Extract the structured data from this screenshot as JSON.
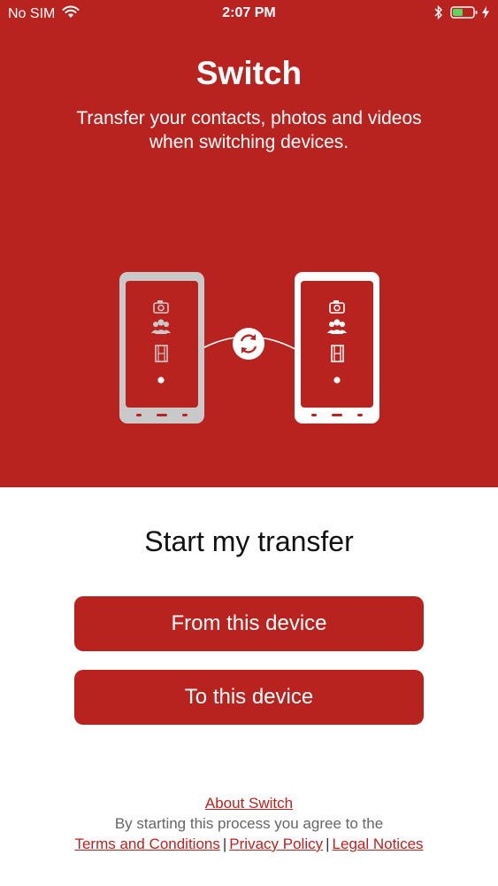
{
  "status_bar": {
    "carrier": "No SIM",
    "time": "2:07 PM",
    "wifi_icon": "wifi-icon",
    "bluetooth_icon": "bluetooth-icon",
    "battery_icon": "battery-icon",
    "charging_icon": "charging-bolt-icon"
  },
  "header": {
    "title": "Switch",
    "subtitle": "Transfer your contacts, photos and videos when switching devices."
  },
  "illustration": {
    "icons": [
      "camera-icon",
      "people-icon",
      "film-icon",
      "sync-icon"
    ]
  },
  "main": {
    "heading": "Start my transfer",
    "from_button": "From this device",
    "to_button": "To this device"
  },
  "footer": {
    "about_link": "About Switch",
    "consent_text": "By starting this process you agree to the",
    "terms_link": "Terms and Conditions",
    "privacy_link": "Privacy Policy",
    "legal_link": "Legal Notices",
    "separator": "|"
  },
  "colors": {
    "brand_red": "#b9231f",
    "white": "#ffffff",
    "old_phone_gray": "#c9c9c9"
  }
}
